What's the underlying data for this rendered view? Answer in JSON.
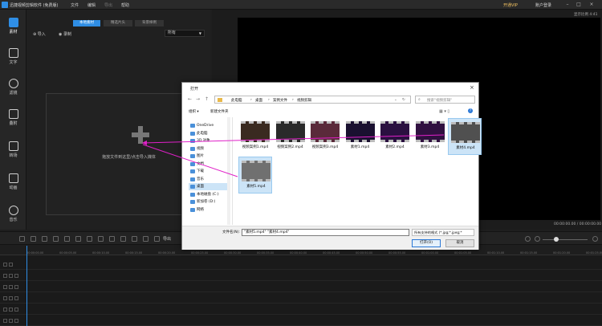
{
  "app": {
    "title": "迅捷视频剪辑软件 (免费版)",
    "menu": [
      "文件",
      "编辑",
      "导出",
      "帮助"
    ],
    "vip": "开通VIP",
    "login": "账户登录"
  },
  "nav": [
    {
      "label": "素材",
      "icon": "media-icon"
    },
    {
      "label": "文字",
      "icon": "text-icon"
    },
    {
      "label": "滤镜",
      "icon": "filter-icon"
    },
    {
      "label": "叠附",
      "icon": "overlay-icon"
    },
    {
      "label": "转场",
      "icon": "transition-icon"
    },
    {
      "label": "动画",
      "icon": "animation-icon"
    },
    {
      "label": "音乐",
      "icon": "music-icon"
    }
  ],
  "media": {
    "tabs": [
      "本地素材",
      "精选片头",
      "背景样例"
    ],
    "import_label": "导入",
    "record_label": "录制",
    "filter_value": "所有",
    "drop_hint": "拖放文件到这里/点击导入媒体"
  },
  "preview": {
    "aspect": "显示比例 4:41",
    "time": "00:00:00.00 / 00:00:00.00"
  },
  "timeline": {
    "export_label": "导出",
    "ticks": [
      "00:00:00.00",
      "00:00:05.00",
      "00:00:10.00",
      "00:00:15.00",
      "00:00:20.00",
      "00:00:25.00",
      "00:00:30.00",
      "00:00:35.00",
      "00:00:40.00",
      "00:00:45.00",
      "00:00:50.00",
      "00:00:55.00",
      "00:01:00.00",
      "00:01:05.00",
      "00:01:10.00",
      "00:01:15.00",
      "00:01:20.00",
      "00:01:25.00"
    ]
  },
  "dialog": {
    "title": "打开",
    "path": [
      "此电脑",
      "桌面",
      "案例文件",
      "视频剪辑"
    ],
    "search_placeholder": "搜索\"视频剪辑\"",
    "organize": "组织 ▾",
    "new_folder": "新建文件夹",
    "sidebar": [
      {
        "label": "OneDrive",
        "icon": "cloud-icon",
        "selected": false
      },
      {
        "label": "此电脑",
        "icon": "computer-icon",
        "selected": false
      },
      {
        "label": "3D 对象",
        "icon": "3d-objects-icon",
        "selected": false
      },
      {
        "label": "视频",
        "icon": "video-folder-icon",
        "selected": false
      },
      {
        "label": "图片",
        "icon": "picture-folder-icon",
        "selected": false
      },
      {
        "label": "文档",
        "icon": "document-folder-icon",
        "selected": false
      },
      {
        "label": "下载",
        "icon": "download-folder-icon",
        "selected": false
      },
      {
        "label": "音乐",
        "icon": "music-folder-icon",
        "selected": false
      },
      {
        "label": "桌面",
        "icon": "desktop-folder-icon",
        "selected": true
      },
      {
        "label": "本地磁盘 (C:)",
        "icon": "drive-icon",
        "selected": false
      },
      {
        "label": "新加卷 (D:)",
        "icon": "drive-icon",
        "selected": false
      },
      {
        "label": "网络",
        "icon": "network-icon",
        "selected": false
      }
    ],
    "files": [
      {
        "name": "视频案例1.mp4",
        "selected": false
      },
      {
        "name": "视频案例2.mp4",
        "selected": false
      },
      {
        "name": "视频案例3.mp4",
        "selected": false
      },
      {
        "name": "素材1.mp4",
        "selected": false
      },
      {
        "name": "素材2.mp4",
        "selected": false
      },
      {
        "name": "素材3.mp4",
        "selected": false
      },
      {
        "name": "素材4.mp4",
        "selected": true
      },
      {
        "name": "素材5.mp4",
        "selected": true
      }
    ],
    "filename_label": "文件名(N):",
    "filename_value": "\"素材5.mp4\" \"素材4.mp4\"",
    "filetype_value": "所有支持的格式 (*.jpg;*.jpeg;*",
    "open_label": "打开(O)",
    "cancel_label": "取消"
  },
  "colors": {
    "accent": "#2f8ee5",
    "arrow": "#e020c8"
  }
}
